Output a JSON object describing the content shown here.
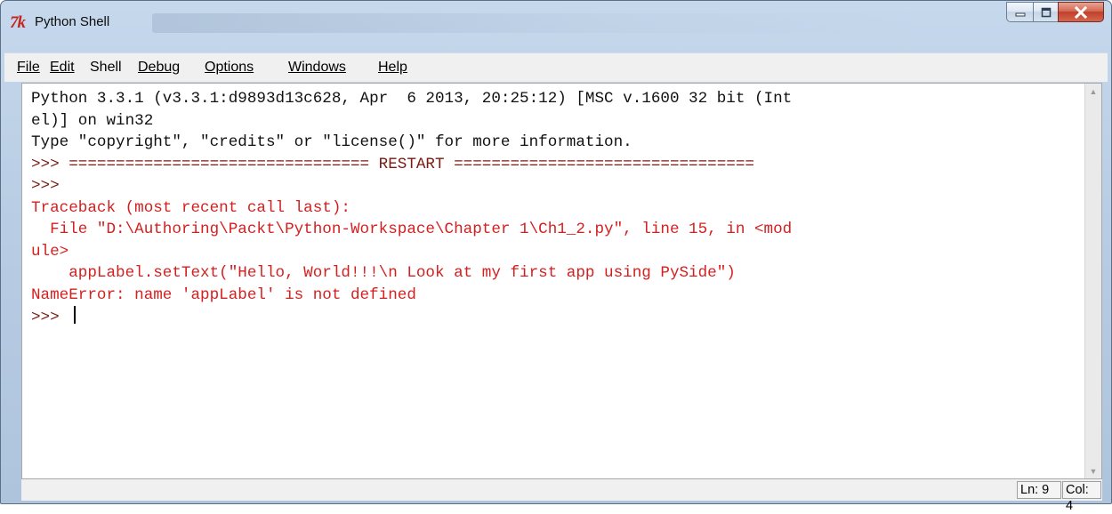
{
  "window": {
    "title": "Python Shell",
    "controls": {
      "minimize": "minimize-icon",
      "maximize": "maximize-icon",
      "close": "close-icon"
    }
  },
  "menu": [
    "File",
    "Edit",
    "Shell",
    "Debug",
    "Options",
    "Windows",
    "Help"
  ],
  "shell": {
    "lines": [
      {
        "text": "Python 3.3.1 (v3.3.1:d9893d13c628, Apr  6 2013, 20:25:12) [MSC v.1600 32 bit (Int",
        "style": "black"
      },
      {
        "text": "el)] on win32",
        "style": "black"
      },
      {
        "text": "Type \"copyright\", \"credits\" or \"license()\" for more information.",
        "style": "black"
      },
      {
        "text": ">>> ================================ RESTART ================================",
        "style": "prompt"
      },
      {
        "text": ">>> ",
        "style": "prompt"
      },
      {
        "text": "Traceback (most recent call last):",
        "style": "red"
      },
      {
        "text": "  File \"D:\\Authoring\\Packt\\Python-Workspace\\Chapter 1\\Ch1_2.py\", line 15, in <mod",
        "style": "red"
      },
      {
        "text": "ule>",
        "style": "red"
      },
      {
        "text": "    appLabel.setText(\"Hello, World!!!\\n Look at my first app using PySide\")",
        "style": "red"
      },
      {
        "text": "NameError: name 'appLabel' is not defined",
        "style": "red"
      },
      {
        "text": ">>> ",
        "style": "prompt",
        "cursor": true
      }
    ]
  },
  "status": {
    "line": "Ln: 9",
    "col": "Col: 4"
  }
}
